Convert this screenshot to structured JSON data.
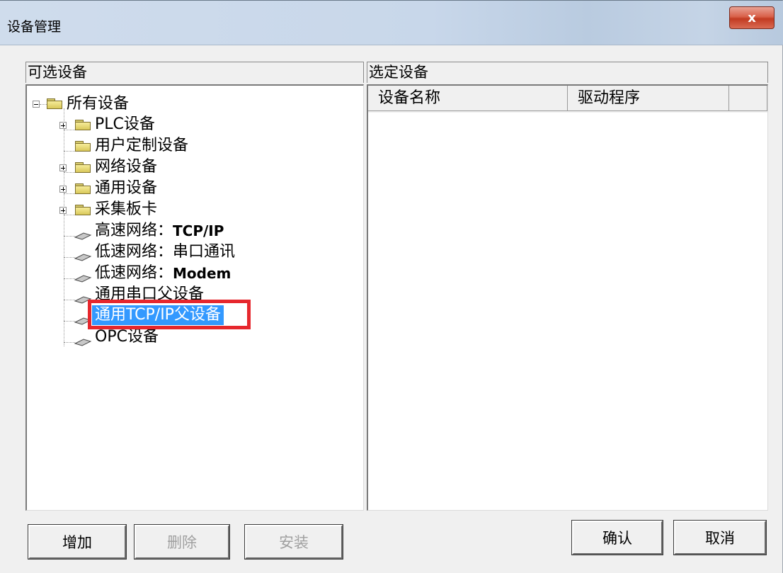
{
  "window": {
    "title": "设备管理",
    "close_glyph": "x"
  },
  "left_panel": {
    "label": "可选设备",
    "tree": {
      "root": "所有设备",
      "items": [
        {
          "label": "PLC设备"
        },
        {
          "label": "用户定制设备"
        },
        {
          "label": "网络设备"
        },
        {
          "label": "通用设备"
        },
        {
          "label": "采集板卡"
        },
        {
          "prefix": "高速网络：",
          "suffix": "TCP/IP"
        },
        {
          "prefix": "低速网络：",
          "suffix": "串口通讯"
        },
        {
          "prefix": "低速网络：",
          "suffix": "Modem"
        },
        {
          "label": "通用串口父设备"
        },
        {
          "label": "通用TCP/IP父设备",
          "selected": true
        },
        {
          "label": "OPC设备"
        }
      ]
    }
  },
  "right_panel": {
    "label": "选定设备",
    "columns": [
      "设备名称",
      "驱动程序"
    ]
  },
  "buttons": {
    "add": "增加",
    "delete": "删除",
    "install": "安装",
    "ok": "确认",
    "cancel": "取消"
  },
  "colors": {
    "selection": "#3399ff",
    "highlight_box": "#e6272d"
  }
}
